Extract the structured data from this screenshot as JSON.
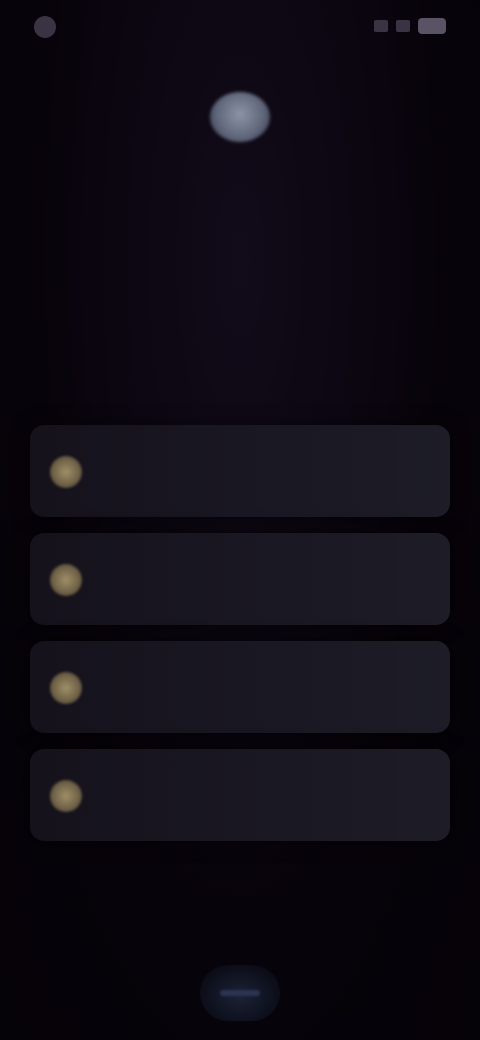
{
  "status_bar": {
    "left_text": "",
    "icons": [
      "signal-icon",
      "wifi-icon",
      "battery-icon"
    ]
  },
  "header": {
    "icon": "profile-avatar-icon",
    "title_line_1": "",
    "title_line_2": ""
  },
  "options": [
    {
      "icon": "option-icon",
      "label": ""
    },
    {
      "icon": "option-icon",
      "label": ""
    },
    {
      "icon": "option-icon",
      "label": ""
    },
    {
      "icon": "option-icon",
      "label": ""
    }
  ],
  "bottom_button": {
    "icon": "continue-icon"
  },
  "colors": {
    "background": "#07030a",
    "card": "#1a1822",
    "accent": "#a08f68"
  }
}
